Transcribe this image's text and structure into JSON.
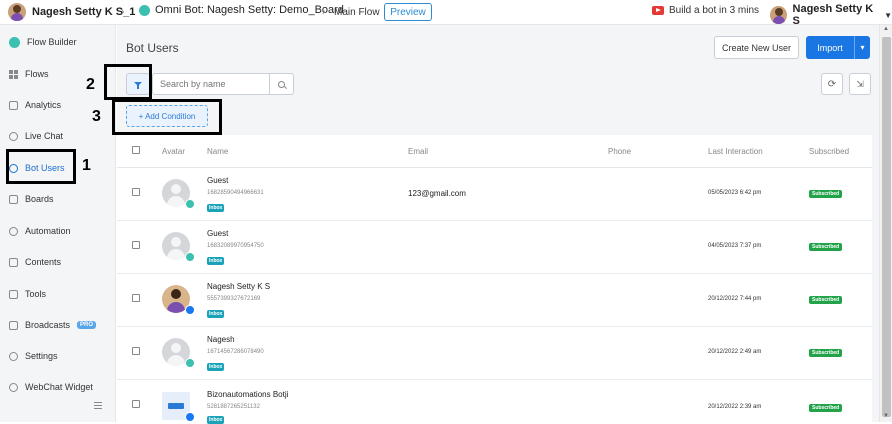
{
  "header": {
    "user_name": "Nagesh Setty K S_1",
    "bot_title": "Omni Bot: Nagesh Setty: Demo_Board",
    "flow_name": "Main Flow",
    "preview_label": "Preview",
    "tutorial_label": "Build a bot in 3 mins",
    "account_name": "Nagesh Setty K S"
  },
  "sidebar": {
    "items": [
      {
        "label": "Flow Builder",
        "icon": "flow-builder-icon"
      },
      {
        "label": "Flows",
        "icon": "grid-icon"
      },
      {
        "label": "Analytics",
        "icon": "analytics-icon"
      },
      {
        "label": "Live Chat",
        "icon": "headset-icon"
      },
      {
        "label": "Bot Users",
        "icon": "user-icon"
      },
      {
        "label": "Boards",
        "icon": "board-icon"
      },
      {
        "label": "Automation",
        "icon": "automation-icon"
      },
      {
        "label": "Contents",
        "icon": "contents-icon"
      },
      {
        "label": "Tools",
        "icon": "tools-icon"
      },
      {
        "label": "Broadcasts",
        "icon": "megaphone-icon"
      },
      {
        "label": "Settings",
        "icon": "gear-icon"
      },
      {
        "label": "WebChat Widget",
        "icon": "chat-icon"
      }
    ],
    "pro_badge": "PRO",
    "active_item": "Bot Users"
  },
  "main": {
    "title": "Bot Users",
    "create_button": "Create New User",
    "import_button": "Import",
    "search_placeholder": "Search by name",
    "add_condition": "+ Add Condition"
  },
  "annotations": {
    "one": "1",
    "two": "2",
    "three": "3"
  },
  "table": {
    "columns": [
      "Avatar",
      "Name",
      "Email",
      "Phone",
      "Last Interaction",
      "Subscribed"
    ],
    "rows": [
      {
        "name": "Guest",
        "id": "16828590494966631",
        "badge": "Inbox",
        "email": "123@gmail.com",
        "phone": "",
        "last": "05/05/2023 6:42 pm",
        "subscribed": "Subscribed",
        "channel": "webchat",
        "avatar": "placeholder"
      },
      {
        "name": "Guest",
        "id": "16832089970954750",
        "badge": "Inbox",
        "email": "",
        "phone": "",
        "last": "04/05/2023 7:37 pm",
        "subscribed": "Subscribed",
        "channel": "webchat",
        "avatar": "placeholder"
      },
      {
        "name": "Nagesh Setty K S",
        "id": "5557399327672169",
        "badge": "Inbox",
        "email": "",
        "phone": "",
        "last": "20/12/2022 7:44 pm",
        "subscribed": "Subscribed",
        "channel": "messenger",
        "avatar": "photo"
      },
      {
        "name": "Nagesh",
        "id": "16714567286078490",
        "badge": "Inbox",
        "email": "",
        "phone": "",
        "last": "20/12/2022 2:49 am",
        "subscribed": "Subscribed",
        "channel": "webchat",
        "avatar": "placeholder"
      },
      {
        "name": "Bizonautomations Botji",
        "id": "5281887265251132",
        "badge": "Inbox",
        "email": "",
        "phone": "",
        "last": "20/12/2022 2:39 am",
        "subscribed": "Subscribed",
        "channel": "messenger",
        "avatar": "logo"
      }
    ]
  },
  "colors": {
    "accent": "#1976e3",
    "subscribed": "#22a34a",
    "inbox": "#1aa3b8",
    "sidebar_bg": "#f4f5f7",
    "annotation": "#000000"
  }
}
